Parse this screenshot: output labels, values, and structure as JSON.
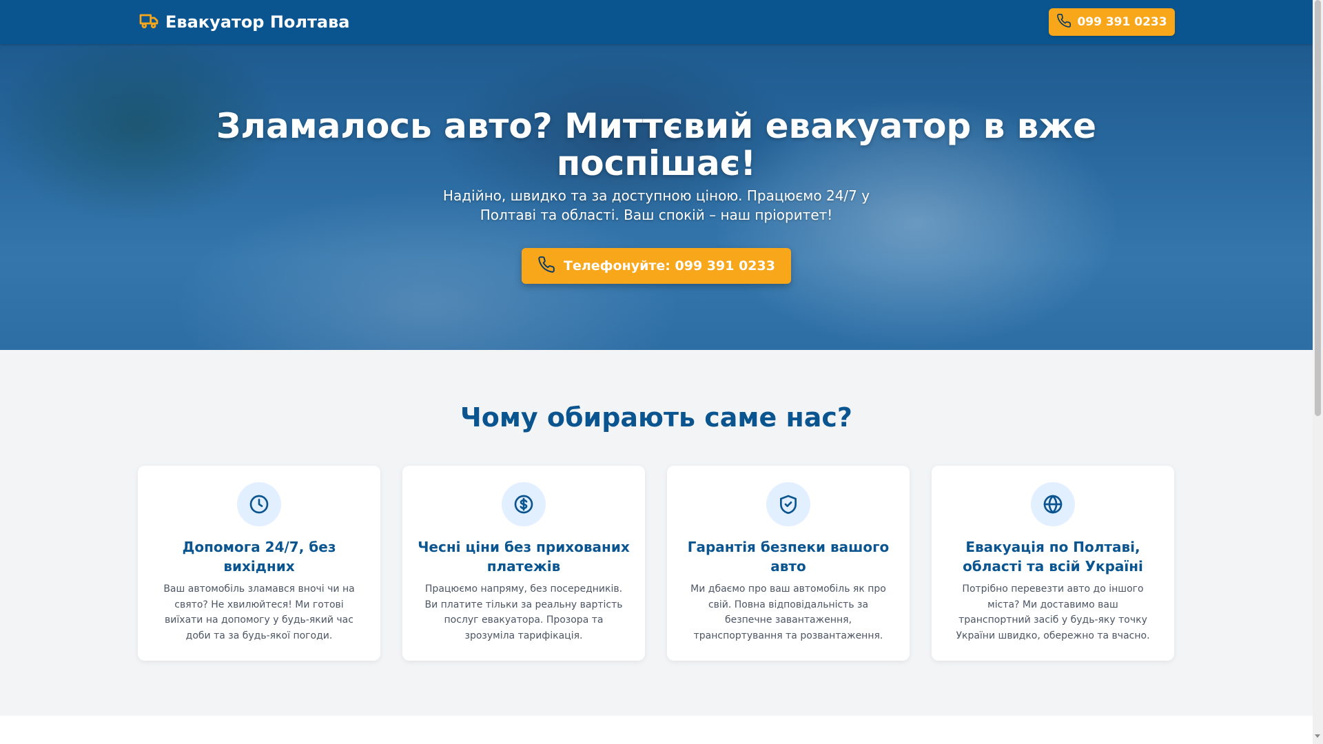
{
  "header": {
    "brand": "Евакуатор Полтава",
    "phone_label": "099 391 0233"
  },
  "hero": {
    "title": "Зламалось авто? Миттєвий евакуатор в вже поспішає!",
    "subtitle": "Надійно, швидко та за доступною ціною. Працюємо 24/7 у Полтаві та області. Ваш спокій – наш пріоритет!",
    "cta_label": "Телефонуйте: 099 391 0233"
  },
  "features": {
    "title": "Чому обирають саме нас?",
    "cards": [
      {
        "icon": "clock-icon",
        "title": "Допомога 24/7, без вихідних",
        "text": "Ваш автомобіль зламався вночі чи на свято? Не хвилюйтеся! Ми готові виїхати на допомогу у будь-який час доби та за будь-якої погоди."
      },
      {
        "icon": "dollar-icon",
        "title": "Чесні ціни без прихованих платежів",
        "text": "Працюємо напряму, без посередників. Ви платите тільки за реальну вартість послуг евакуатора. Прозора та зрозуміла тарифікація."
      },
      {
        "icon": "shield-check-icon",
        "title": "Гарантія безпеки вашого авто",
        "text": "Ми дбаємо про ваш автомобіль як про свій. Повна відповідальність за безпечне завантаження, транспортування та розвантаження."
      },
      {
        "icon": "globe-icon",
        "title": "Евакуація по Полтаві, області та всій Україні",
        "text": "Потрібно перевезти авто до іншого міста? Ми доставимо ваш транспортний засіб у будь-яку точку України швидко, обережно та вчасно."
      }
    ]
  },
  "colors": {
    "primary": "#0a5590",
    "accent": "#f8a61a",
    "icon_bg": "#e1efff",
    "background": "#f3f4f6"
  }
}
